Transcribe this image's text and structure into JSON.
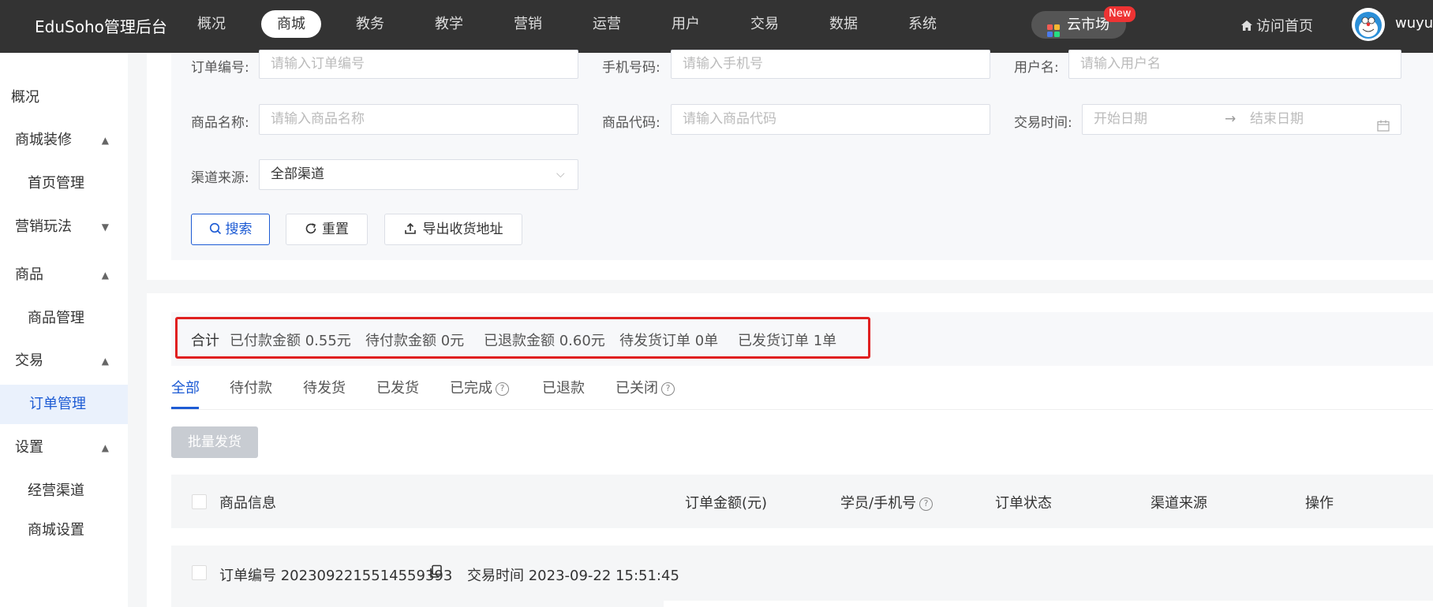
{
  "header": {
    "brand": "EduSoho管理后台",
    "nav": [
      "概况",
      "商城",
      "教务",
      "教学",
      "营销",
      "运营",
      "用户",
      "交易",
      "数据",
      "系统"
    ],
    "active_nav": "商城",
    "cloud_market": "云市场",
    "new_badge": "New",
    "visit_home": "访问首页",
    "username": "wuyue"
  },
  "sidebar": {
    "items": [
      {
        "label": "概况"
      },
      {
        "label": "商城装修"
      },
      {
        "label": "首页管理"
      },
      {
        "label": "营销玩法"
      },
      {
        "label": "商品"
      },
      {
        "label": "商品管理"
      },
      {
        "label": "交易"
      },
      {
        "label": "订单管理"
      },
      {
        "label": "设置"
      },
      {
        "label": "经营渠道"
      },
      {
        "label": "商城设置"
      }
    ]
  },
  "filters": {
    "order_no_label": "订单编号:",
    "order_no_placeholder": "请输入订单编号",
    "phone_label": "手机号码:",
    "phone_placeholder": "请输入手机号",
    "username_label": "用户名:",
    "username_placeholder": "请输入用户名",
    "product_name_label": "商品名称:",
    "product_name_placeholder": "请输入商品名称",
    "product_code_label": "商品代码:",
    "product_code_placeholder": "请输入商品代码",
    "trade_time_label": "交易时间:",
    "start_date": "开始日期",
    "end_date": "结束日期",
    "channel_label": "渠道来源:",
    "channel_value": "全部渠道",
    "search": "搜索",
    "reset": "重置",
    "export": "导出收货地址"
  },
  "summary": {
    "total": "合计",
    "paid": "已付款金额 0.55元",
    "pending_pay": "待付款金额 0元",
    "refunded": "已退款金额 0.60元",
    "to_ship": "待发货订单 0单",
    "shipped": "已发货订单 1单"
  },
  "tabs": [
    "全部",
    "待付款",
    "待发货",
    "已发货",
    "已完成",
    "已退款",
    "已关闭"
  ],
  "batch_ship": "批量发货",
  "table": {
    "headers": [
      "商品信息",
      "订单金额(元)",
      "学员/手机号",
      "订单状态",
      "渠道来源",
      "操作"
    ]
  },
  "order": {
    "order_no": "订单编号 2023092215514559393",
    "trade_time": "交易时间 2023-09-22 15:51:45"
  },
  "colors": {
    "primary": "#1d5bd4",
    "topbar": "#333333",
    "highlight": "#e02020"
  }
}
